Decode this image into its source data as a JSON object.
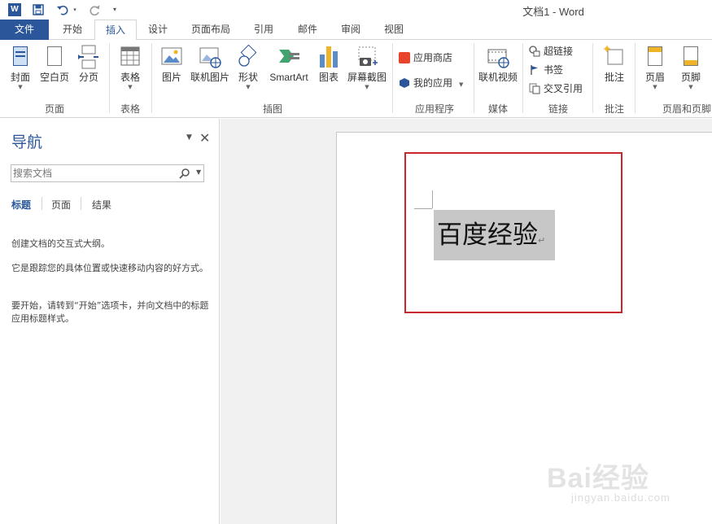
{
  "window": {
    "title": "文档1 - Word",
    "app_logo": "W"
  },
  "tabs": [
    "文件",
    "开始",
    "插入",
    "设计",
    "页面布局",
    "引用",
    "邮件",
    "审阅",
    "视图"
  ],
  "active_tab": "插入",
  "ribbon": {
    "pages": {
      "cover": "封面",
      "blank": "空白页",
      "break": "分页",
      "group": "页面"
    },
    "tables": {
      "table": "表格",
      "group": "表格"
    },
    "illustrations": {
      "picture": "图片",
      "online_picture": "联机图片",
      "shapes": "形状",
      "smartart": "SmartArt",
      "chart": "图表",
      "screenshot": "屏幕截图",
      "group": "插图"
    },
    "apps": {
      "store": "应用商店",
      "my_apps": "我的应用",
      "group": "应用程序"
    },
    "media": {
      "online_video": "联机视频",
      "group": "媒体"
    },
    "links": {
      "hyperlink": "超链接",
      "bookmark": "书签",
      "cross_ref": "交叉引用",
      "group": "链接"
    },
    "comments": {
      "comment": "批注",
      "group": "批注"
    },
    "header_footer": {
      "header": "页眉",
      "footer": "页脚",
      "group": "页眉和页脚"
    }
  },
  "nav": {
    "title": "导航",
    "search_placeholder": "搜索文档",
    "tabs": [
      "标题",
      "页面",
      "结果"
    ],
    "text1": "创建文档的交互式大纲。",
    "text2": "它是跟踪您的具体位置或快速移动内容的好方式。",
    "text3": "要开始，请转到“开始”选项卡，并向文档中的标题应用标题样式。"
  },
  "document": {
    "selected_text": "百度经验",
    "para_mark": "↵"
  },
  "watermark": {
    "brand": "Bai经验",
    "url": "jingyan.baidu.com"
  },
  "colors": {
    "accent": "#2b579a",
    "highlight_border": "#c9252c",
    "selection": "#c7c7c7"
  }
}
